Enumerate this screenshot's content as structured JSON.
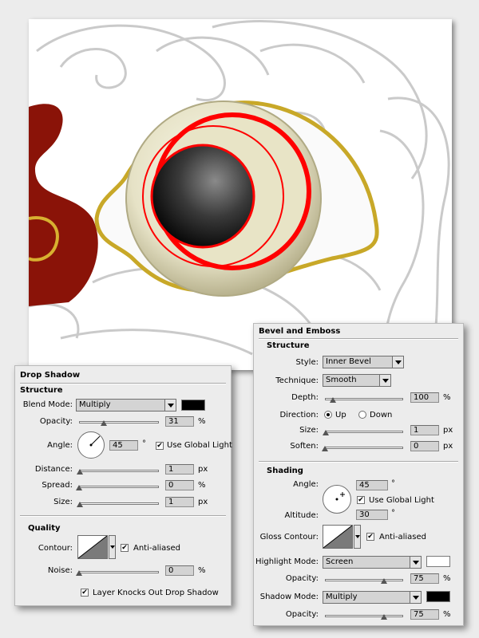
{
  "drop_shadow": {
    "title": "Drop Shadow",
    "structure_title": "Structure",
    "blend_mode_label": "Blend Mode:",
    "blend_mode_value": "Multiply",
    "blend_color": "#000000",
    "opacity_label": "Opacity:",
    "opacity_value": "31",
    "opacity_unit": "%",
    "opacity_level": 0.31,
    "angle_label": "Angle:",
    "angle_value": "45",
    "angle_unit": "°",
    "use_global_light_label": "Use Global Light",
    "use_global_light_checked": "✔",
    "distance_label": "Distance:",
    "distance_value": "1",
    "distance_unit": "px",
    "spread_label": "Spread:",
    "spread_value": "0",
    "spread_unit": "%",
    "size_label": "Size:",
    "size_value": "1",
    "size_unit": "px",
    "quality_title": "Quality",
    "contour_label": "Contour:",
    "anti_aliased_label": "Anti-aliased",
    "anti_aliased_checked": "✔",
    "noise_label": "Noise:",
    "noise_value": "0",
    "noise_unit": "%",
    "knockout_label": "Layer Knocks Out Drop Shadow",
    "knockout_checked": "✔"
  },
  "bevel_emboss": {
    "title": "Bevel and Emboss",
    "structure_title": "Structure",
    "style_label": "Style:",
    "style_value": "Inner Bevel",
    "technique_label": "Technique:",
    "technique_value": "Smooth",
    "depth_label": "Depth:",
    "depth_value": "100",
    "depth_unit": "%",
    "direction_label": "Direction:",
    "direction_up": "Up",
    "direction_down": "Down",
    "size_label": "Size:",
    "size_value": "1",
    "size_unit": "px",
    "soften_label": "Soften:",
    "soften_value": "0",
    "soften_unit": "px",
    "shading_title": "Shading",
    "angle_label": "Angle:",
    "angle_value": "45",
    "angle_unit": "°",
    "use_global_light_label": "Use Global Light",
    "use_global_light_checked": "✔",
    "altitude_label": "Altitude:",
    "altitude_value": "30",
    "altitude_unit": "°",
    "gloss_contour_label": "Gloss Contour:",
    "anti_aliased_label": "Anti-aliased",
    "anti_aliased_checked": "✔",
    "highlight_mode_label": "Highlight Mode:",
    "highlight_mode_value": "Screen",
    "highlight_color": "#ffffff",
    "highlight_opacity_label": "Opacity:",
    "highlight_opacity_value": "75",
    "highlight_opacity_unit": "%",
    "shadow_mode_label": "Shadow Mode:",
    "shadow_mode_value": "Multiply",
    "shadow_color": "#000000",
    "shadow_opacity_label": "Opacity:",
    "shadow_opacity_value": "75",
    "shadow_opacity_unit": "%"
  },
  "colors": {
    "eye_ring": "#c8a828",
    "iris_red": "#ff0000",
    "feather_red": "#8a1308"
  }
}
